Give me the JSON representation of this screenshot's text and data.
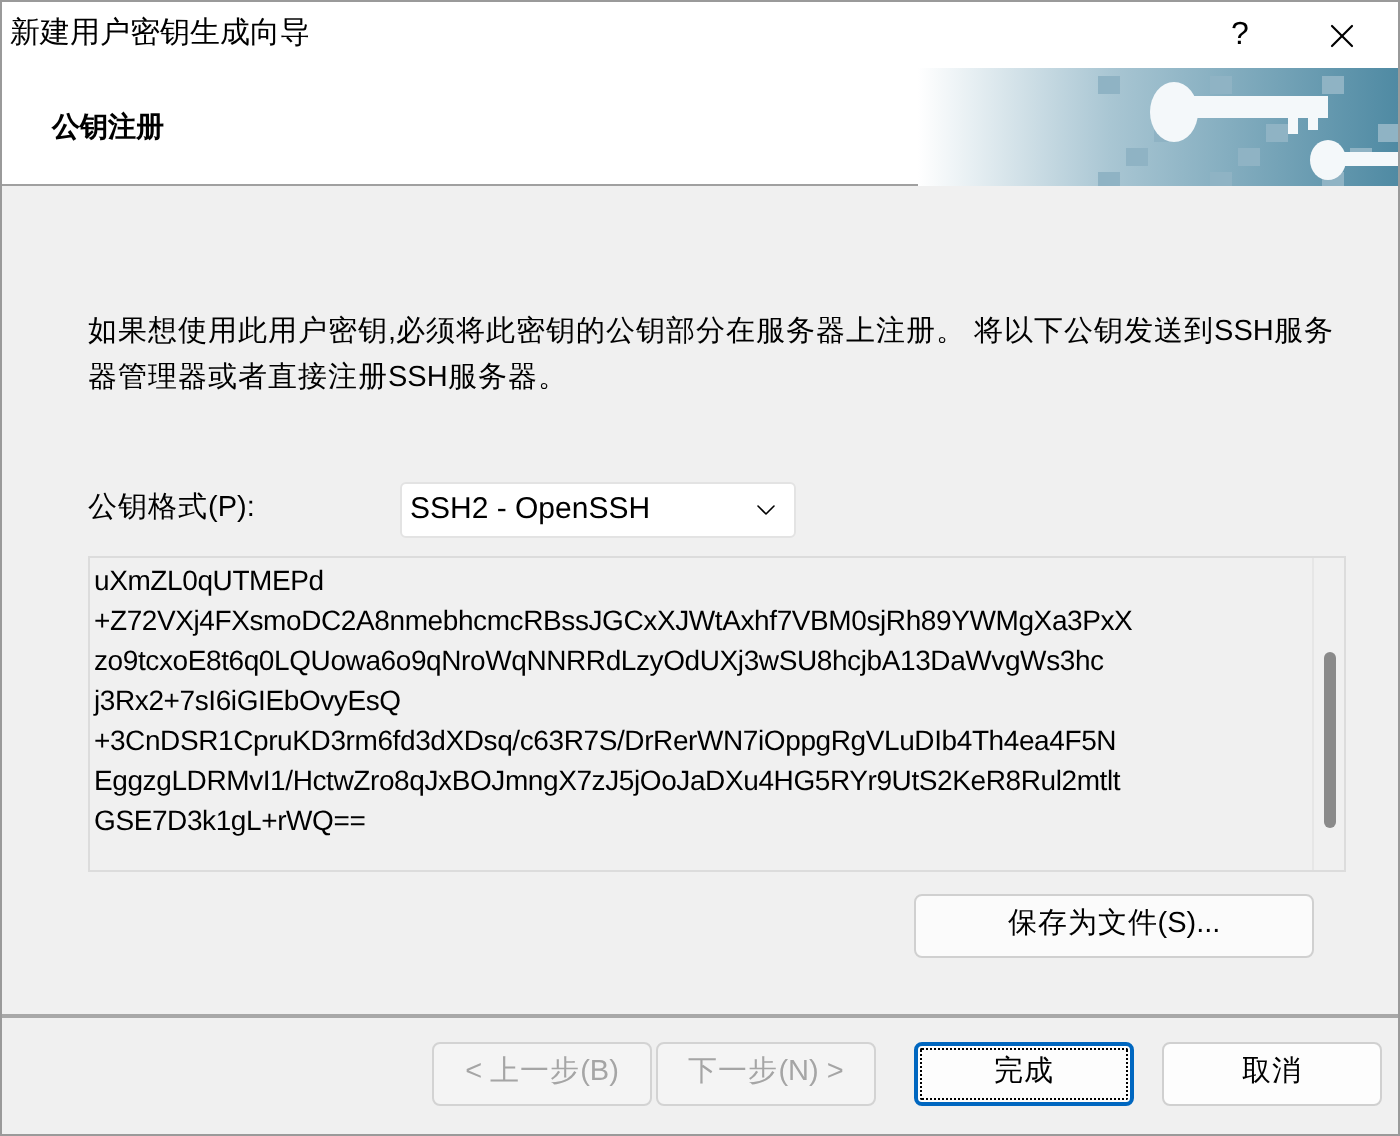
{
  "window": {
    "title": "新建用户密钥生成向导",
    "help": "?"
  },
  "header": {
    "title": "公钥注册"
  },
  "description": "如果想使用此用户密钥,必须将此密钥的公钥部分在服务器上注册。 将以下公钥发送到SSH服务器管理器或者直接注册SSH服务器。",
  "format": {
    "label": "公钥格式(P):",
    "value": "SSH2 - OpenSSH"
  },
  "public_key_lines": [
    "uXmZL0qUTMEPd",
    "+Z72VXj4FXsmoDC2A8nmebhcmcRBssJGCxXJWtAxhf7VBM0sjRh89YWMgXa3PxX",
    "zo9tcxoE8t6q0LQUowa6o9qNroWqNNRRdLzyOdUXj3wSU8hcjbA13DaWvgWs3hc",
    "j3Rx2+7sI6iGIEbOvyEsQ",
    "+3CnDSR1CpruKD3rm6fd3dXDsq/c63R7S/DrRerWN7iOppgRgVLuDIb4Th4ea4F5N",
    "EggzgLDRMvI1/HctwZro8qJxBOJmngX7zJ5jOoJaDXu4HG5RYr9UtS2KeR8Rul2mtlt",
    "GSE7D3k1gL+rWQ=="
  ],
  "save_button": "保存为文件(S)...",
  "buttons": [
    {
      "label": "< 上一步(B)",
      "disabled": true,
      "default": false
    },
    {
      "label": "下一步(N) >",
      "disabled": true,
      "default": false
    },
    {
      "label": "完成",
      "disabled": false,
      "default": true
    },
    {
      "label": "取消",
      "disabled": false,
      "default": false
    }
  ]
}
